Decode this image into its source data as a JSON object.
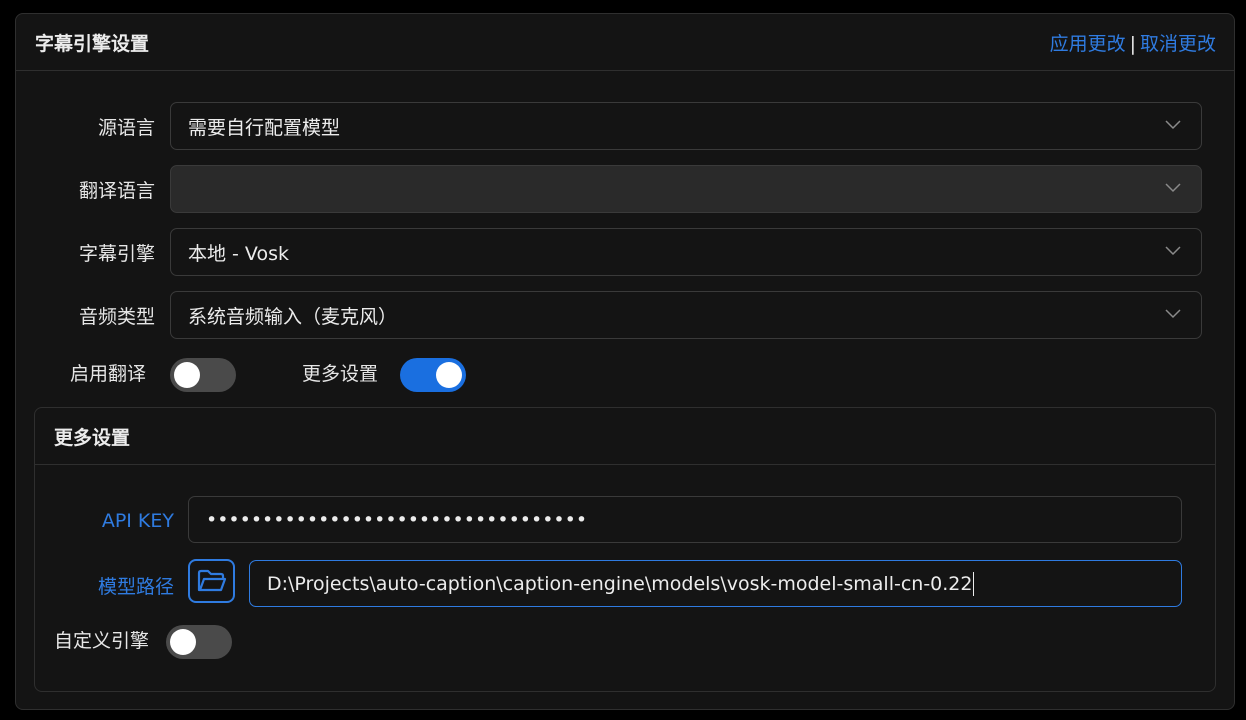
{
  "header": {
    "title": "字幕引擎设置",
    "apply_label": "应用更改",
    "separator": "|",
    "cancel_label": "取消更改"
  },
  "fields": {
    "source_language": {
      "label": "源语言",
      "value": "需要自行配置模型"
    },
    "translate_language": {
      "label": "翻译语言",
      "value": ""
    },
    "caption_engine": {
      "label": "字幕引擎",
      "value": "本地 - Vosk"
    },
    "audio_type": {
      "label": "音频类型",
      "value": "系统音频输入（麦克风）"
    }
  },
  "toggles": {
    "enable_translation": {
      "label": "启用翻译",
      "on": false
    },
    "more_settings": {
      "label": "更多设置",
      "on": true
    },
    "custom_engine": {
      "label": "自定义引擎",
      "on": false
    }
  },
  "more_settings_panel": {
    "title": "更多设置",
    "api_key": {
      "label": "API KEY",
      "value": "••••••••••••••••••••••••••••••••••"
    },
    "model_path": {
      "label": "模型路径",
      "value": "D:\\Projects\\auto-caption\\caption-engine\\models\\vosk-model-small-cn-0.22"
    }
  },
  "colors": {
    "accent": "#2f7be0",
    "switch_on": "#1a6fe0",
    "switch_off": "#4a4a4a",
    "background": "#141414"
  }
}
